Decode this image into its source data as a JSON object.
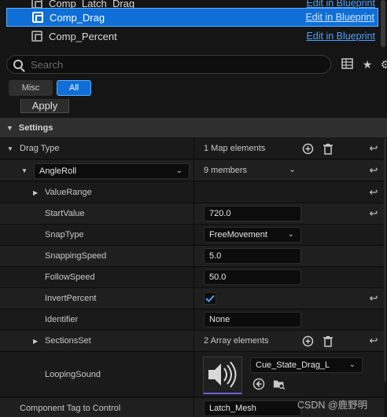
{
  "components": [
    {
      "name": "Comp_Latch_Drag",
      "link": "Edit in Blueprint"
    },
    {
      "name": "Comp_Drag",
      "link": "Edit in Blueprint",
      "selected": true
    },
    {
      "name": "Comp_Percent",
      "link": "Edit in Blueprint"
    }
  ],
  "search": {
    "placeholder": "Search"
  },
  "filters": {
    "misc": "Misc",
    "all": "All"
  },
  "apply_label": "Apply",
  "section": {
    "title": "Settings"
  },
  "drag_type": {
    "label": "Drag Type",
    "value": "1 Map elements"
  },
  "angle_roll": {
    "key": "AngleRoll",
    "value": "9 members"
  },
  "rows": {
    "value_range": "ValueRange",
    "start_value": {
      "label": "StartValue",
      "value": "720.0"
    },
    "snap_type": {
      "label": "SnapType",
      "value": "FreeMovement"
    },
    "snapping_speed": {
      "label": "SnappingSpeed",
      "value": "5.0"
    },
    "follow_speed": {
      "label": "FollowSpeed",
      "value": "50.0"
    },
    "invert_percent": {
      "label": "InvertPercent",
      "checked": true
    },
    "identifier": {
      "label": "Identifier",
      "value": "None"
    },
    "sections_set": {
      "label": "SectionsSet",
      "value": "2 Array elements"
    },
    "looping_sound": {
      "label": "LoopingSound",
      "asset": "Cue_State_Drag_L"
    },
    "component_tag": {
      "label": "Component Tag to Control",
      "value": "Latch_Mesh"
    }
  },
  "watermark": "CSDN @鹿野明",
  "colors": {
    "accent": "#0f6fd6",
    "link": "#4aa3ff",
    "background": "#151515"
  }
}
